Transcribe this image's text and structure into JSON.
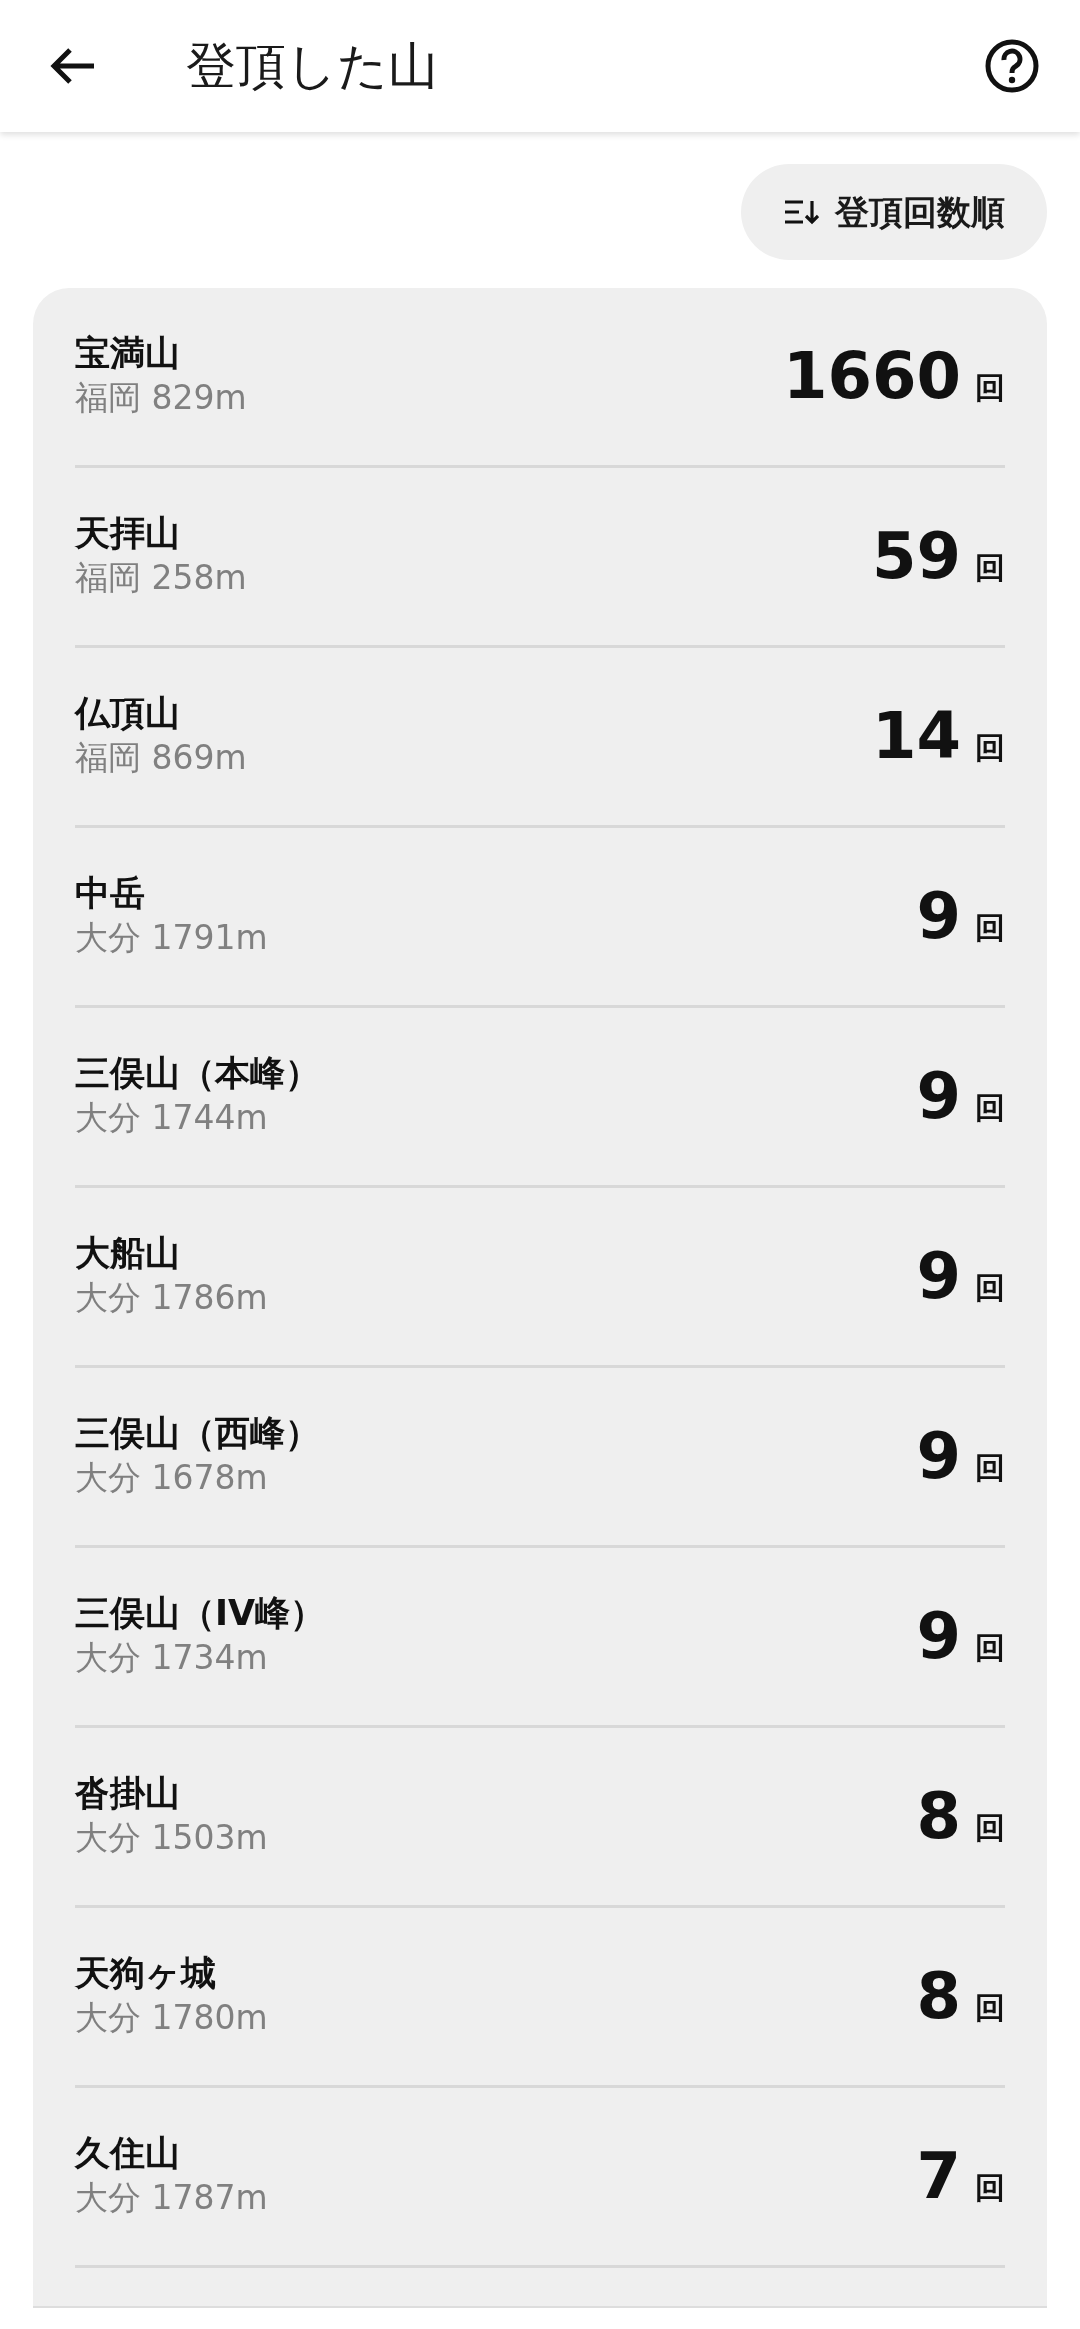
{
  "header": {
    "title": "登頂した山"
  },
  "sort_button": {
    "label": "登頂回数順"
  },
  "mountains": [
    {
      "name": "宝満山",
      "location": "福岡 829m",
      "count": "1660",
      "unit": "回"
    },
    {
      "name": "天拝山",
      "location": "福岡 258m",
      "count": "59",
      "unit": "回"
    },
    {
      "name": "仏頂山",
      "location": "福岡 869m",
      "count": "14",
      "unit": "回"
    },
    {
      "name": "中岳",
      "location": "大分 1791m",
      "count": "9",
      "unit": "回"
    },
    {
      "name": "三俣山（本峰）",
      "location": "大分 1744m",
      "count": "9",
      "unit": "回"
    },
    {
      "name": "大船山",
      "location": "大分 1786m",
      "count": "9",
      "unit": "回"
    },
    {
      "name": "三俣山（西峰）",
      "location": "大分 1678m",
      "count": "9",
      "unit": "回"
    },
    {
      "name": "三俣山（IV峰）",
      "location": "大分 1734m",
      "count": "9",
      "unit": "回"
    },
    {
      "name": "沓掛山",
      "location": "大分 1503m",
      "count": "8",
      "unit": "回"
    },
    {
      "name": "天狗ヶ城",
      "location": "大分 1780m",
      "count": "8",
      "unit": "回"
    },
    {
      "name": "久住山",
      "location": "大分 1787m",
      "count": "7",
      "unit": "回"
    }
  ]
}
